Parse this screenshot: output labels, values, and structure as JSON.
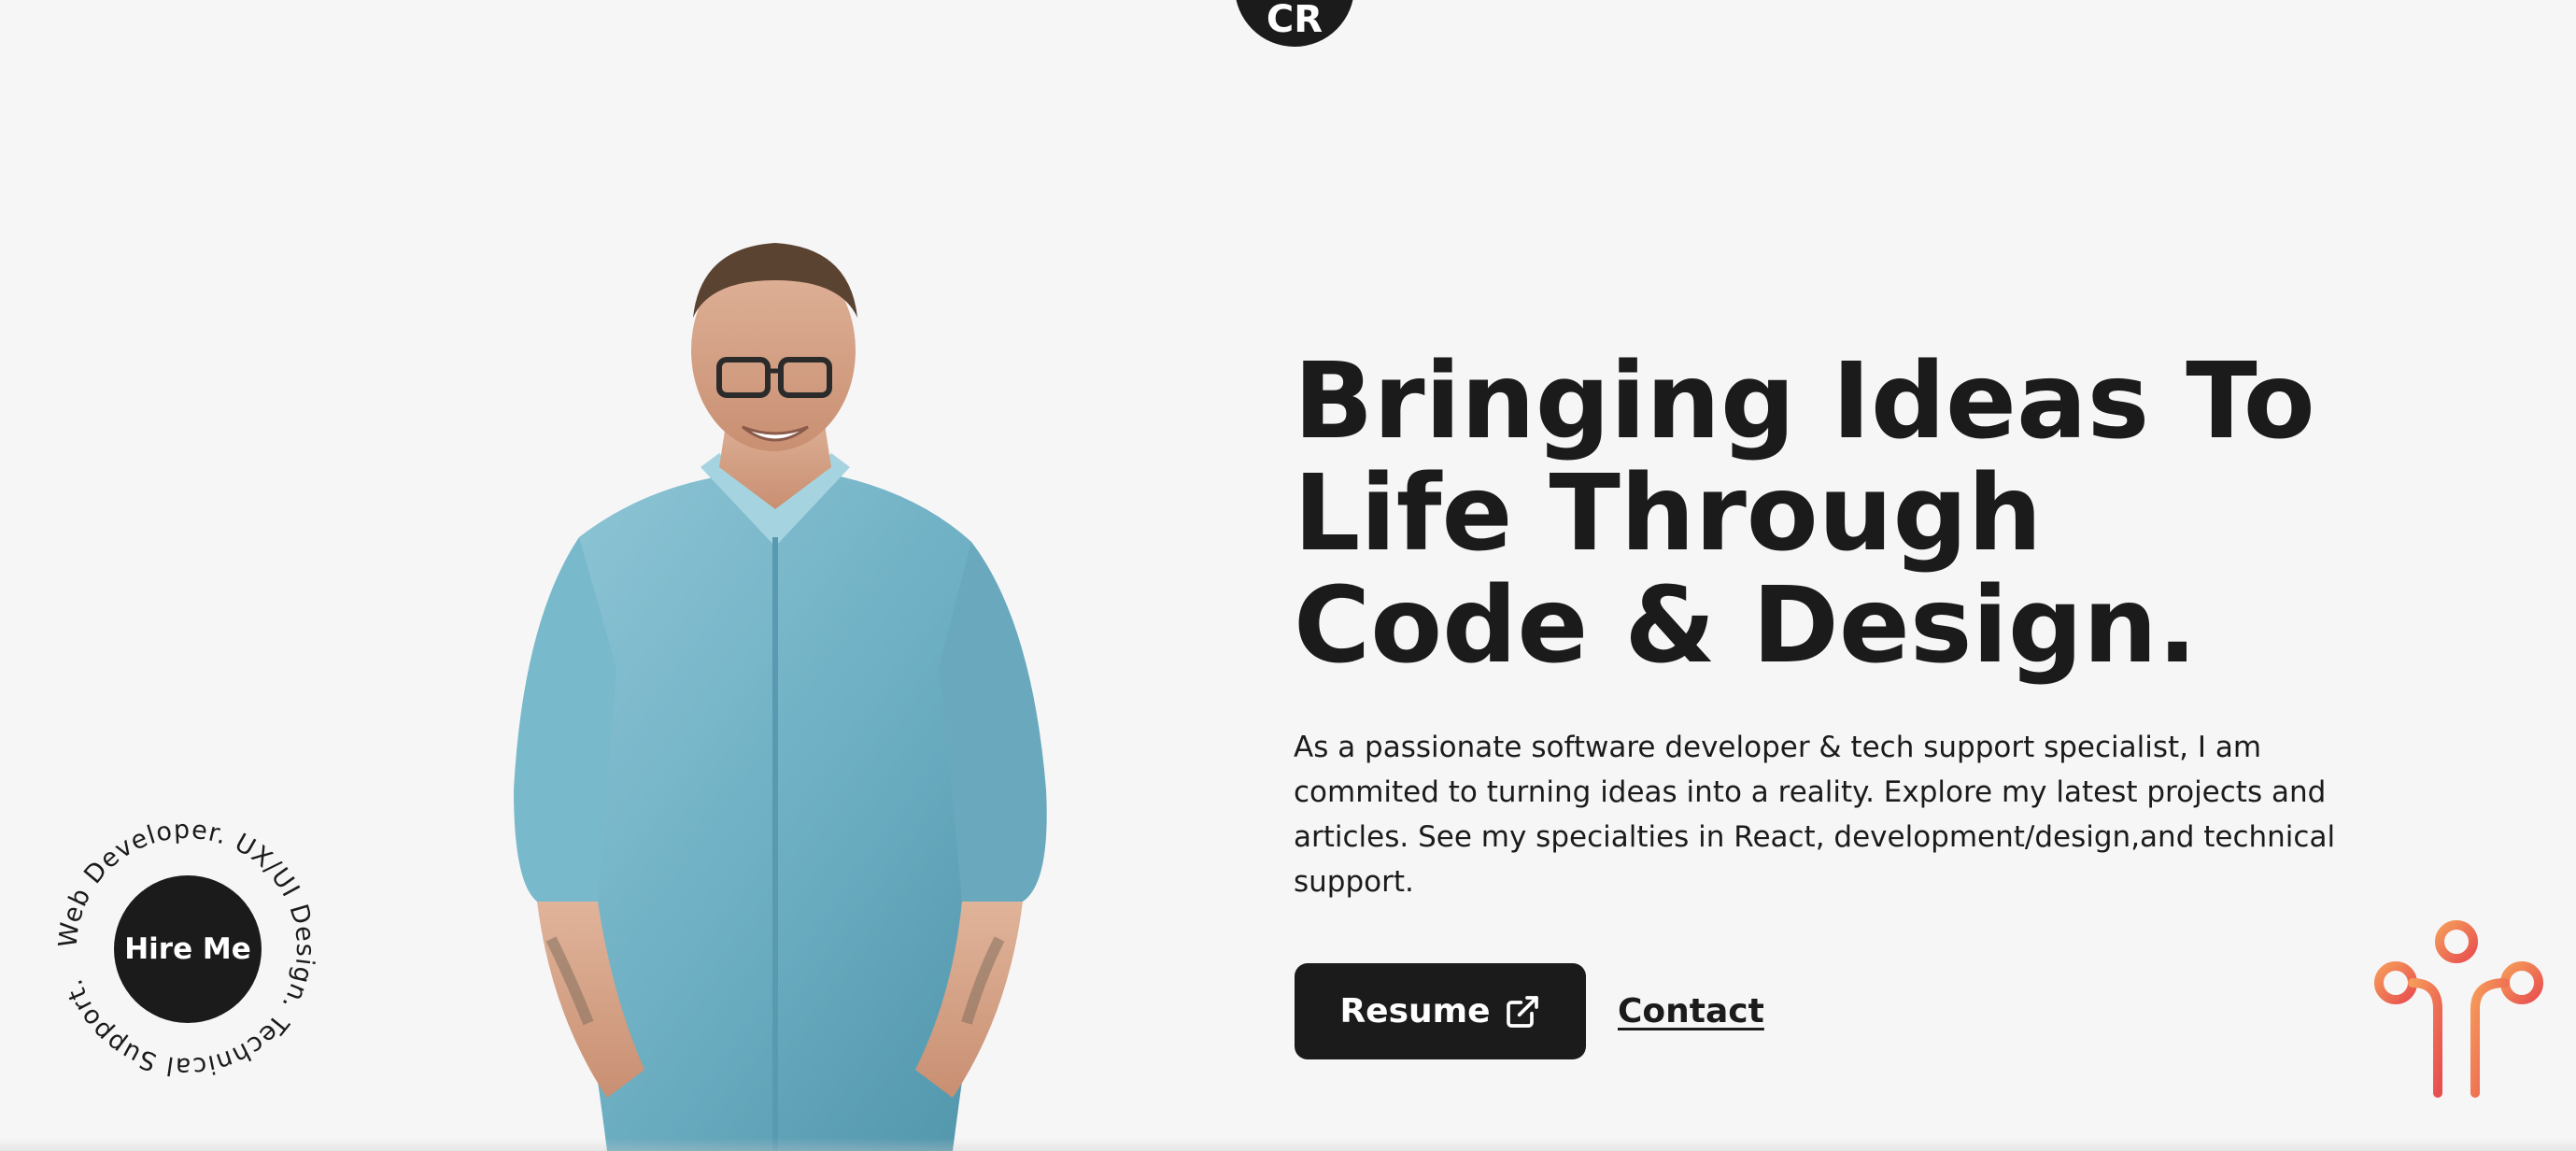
{
  "logo": {
    "text": "CR"
  },
  "hero": {
    "heading": "Bringing Ideas To\nLife Through\nCode & Design.",
    "description": "As a passionate software developer & tech support specialist, I am commited to turning ideas into a reality. Explore my latest projects and articles. See my specialties in React, development/design,and technical support."
  },
  "actions": {
    "resume_label": "Resume",
    "contact_label": "Contact"
  },
  "hire_badge": {
    "label": "Hire Me",
    "ring_text": "Web Developer. UX/UI Design. Technical Support."
  },
  "portrait": {
    "alt": "developer portrait"
  },
  "colors": {
    "background": "#f6f6f7",
    "text": "#1b1b1b",
    "accent_gradient_start": "#f59a5a",
    "accent_gradient_end": "#e8504f"
  }
}
